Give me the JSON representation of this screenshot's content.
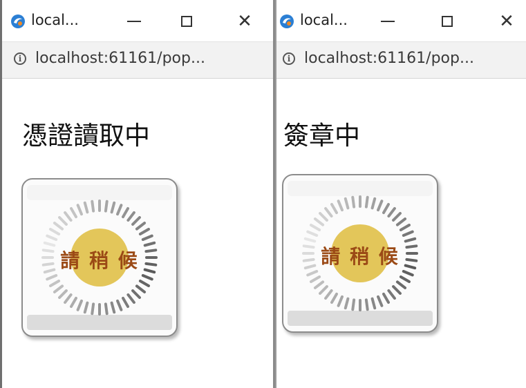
{
  "windows": [
    {
      "title": "local...",
      "url": "localhost:61161/pop...",
      "heading": "憑證讀取中",
      "loading_text": "請 稍 候"
    },
    {
      "title": "local...",
      "url": "localhost:61161/pop...",
      "heading": "簽章中",
      "loading_text": "請 稍 候"
    }
  ],
  "icons": {
    "app": "browser-app-icon",
    "minimize": "minimize-icon",
    "maximize": "maximize-icon",
    "close": "close-icon",
    "info": "info-icon"
  },
  "glyphs": {
    "close": "✕",
    "info": "i"
  },
  "colors": {
    "spinner_center": "#e3c65a",
    "spinner_tick": "#555555",
    "loading_text": "#9b4a16",
    "app_icon": "#2b7fd4"
  }
}
